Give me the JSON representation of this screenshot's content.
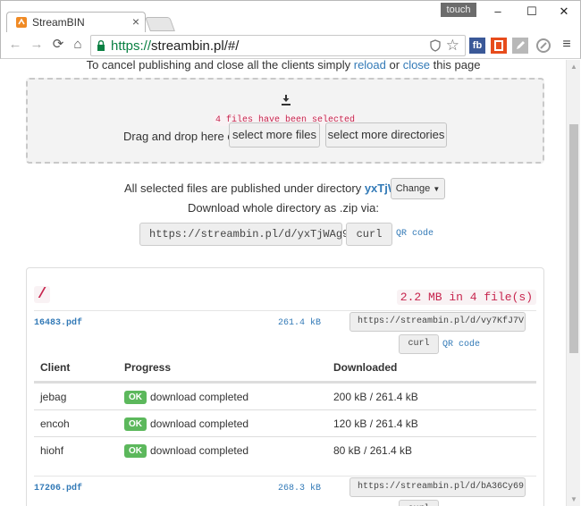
{
  "browser": {
    "tab_title": "StreamBIN",
    "touch_label": "touch",
    "url_scheme": "https://",
    "url_rest": "streambin.pl/#/",
    "extensions": [
      "fb"
    ]
  },
  "page": {
    "cancel_prefix": "To cancel publishing and close all the clients simply",
    "cancel_reload": "reload",
    "cancel_or": "or",
    "cancel_close": "close",
    "cancel_suffix": "this page",
    "files_selected": "4 files have been selected",
    "drag_text": "Drag and drop here or",
    "select_files_label": "select more files",
    "select_dirs_label": "select more directories",
    "published_prefix": "All selected files are published under directory",
    "directory_name": "yxTjWAg9",
    "change_label": "Change",
    "zip_line": "Download whole directory as .zip via:",
    "dir_url": "https://streambin.pl/d/yxTjWAg9",
    "curl_label": "curl",
    "qr_label": "QR code"
  },
  "panel": {
    "root": "/",
    "total_size": "2.2 MB in 4 file(s)",
    "files": [
      {
        "name": "16483.pdf",
        "size": "261.4 kB",
        "url": "https://streambin.pl/d/vy7KfJ7V"
      },
      {
        "name": "17206.pdf",
        "size": "268.3 kB",
        "url": "https://streambin.pl/d/bA36Cy69"
      }
    ],
    "table": {
      "headers": [
        "Client",
        "Progress",
        "Downloaded"
      ],
      "rows": [
        {
          "client": "jebag",
          "status": "OK",
          "progress": "download completed",
          "downloaded": "200 kB / 261.4 kB"
        },
        {
          "client": "encoh",
          "status": "OK",
          "progress": "download completed",
          "downloaded": "120 kB / 261.4 kB"
        },
        {
          "client": "hiohf",
          "status": "OK",
          "progress": "download completed",
          "downloaded": "80 kB / 261.4 kB"
        }
      ]
    }
  },
  "colors": {
    "link": "#337ab7",
    "code": "#c7254e",
    "ok": "#5cb85c"
  }
}
